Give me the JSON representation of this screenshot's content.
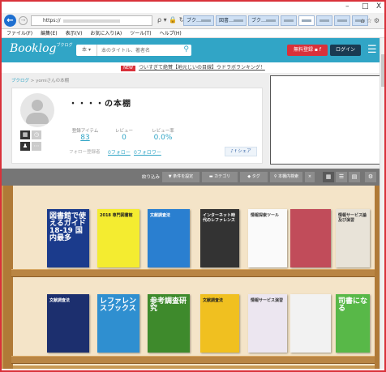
{
  "window": {
    "minimize": "–",
    "restore": "□",
    "close": "X"
  },
  "browser": {
    "url": "https://",
    "tabs": [
      {
        "label": "ブク…",
        "active": false
      },
      {
        "label": "図書…",
        "active": false
      },
      {
        "label": "ブク…",
        "active": false
      },
      {
        "label": "",
        "active": false
      },
      {
        "label": "",
        "active": true
      },
      {
        "label": "",
        "active": false
      },
      {
        "label": "",
        "active": false
      },
      {
        "label": "",
        "active": false
      }
    ],
    "menu": [
      "ファイル(F)",
      "編集(E)",
      "表示(V)",
      "お気に入り(A)",
      "ツール(T)",
      "ヘルプ(H)"
    ]
  },
  "header": {
    "logo": "Booklog",
    "logo_sub": "ブクログ",
    "search_select": "本",
    "search_placeholder": "本のタイトル、著者名",
    "register_label": "無料登録",
    "login_label": "ログイン"
  },
  "notice": {
    "badge": "NEW",
    "text": "ついすぎて絶賛【地元じいの目線】ウドラボランキング！"
  },
  "breadcrumb": {
    "home": "ブクログ",
    "sep": " > ",
    "current": "yomiさんの本棚"
  },
  "profile": {
    "title": "・・・・の本棚",
    "stats": [
      {
        "label": "登録アイテム",
        "value": "83",
        "underline": true
      },
      {
        "label": "レビュー",
        "value": "0",
        "underline": false
      },
      {
        "label": "レビュー率",
        "value": "0.0%",
        "underline": false
      }
    ],
    "registered": "フォロー登録者",
    "following": "0フォロー",
    "followers": "0フォロワー",
    "share": "シェア"
  },
  "filter": {
    "label": "絞り込み",
    "buttons": [
      "条件を設定",
      "カテゴリ",
      "タグ",
      "本棚内検索",
      "×"
    ]
  },
  "books_row1": [
    {
      "title": "図書館で使えるガイド18-19 国内最多",
      "bg": "#1b3b8c",
      "fg": "#fff",
      "big": true
    },
    {
      "title": "2018 専門図書館",
      "bg": "#f4ec30",
      "fg": "#222",
      "big": false
    },
    {
      "title": "文献調査法",
      "bg": "#2a7fd0",
      "fg": "#fff",
      "big": false
    },
    {
      "title": "インターネット時代のレファレンス",
      "bg": "#333",
      "fg": "#fff",
      "big": false
    },
    {
      "title": "情報探索ツール",
      "bg": "#fafafa",
      "fg": "#333",
      "big": false
    },
    {
      "title": "",
      "bg": "#c14c5a",
      "fg": "#fff",
      "big": false
    },
    {
      "title": "情報サービス論及び演習",
      "bg": "#e8e3d8",
      "fg": "#333",
      "big": false
    }
  ],
  "books_row2": [
    {
      "title": "文献調査法",
      "bg": "#1c2f6e",
      "fg": "#fff",
      "big": false
    },
    {
      "title": "レファレンスブックス",
      "bg": "#2f8fd0",
      "fg": "#fff",
      "big": true
    },
    {
      "title": "参考調査研究",
      "bg": "#3e8a2c",
      "fg": "#fff",
      "big": true
    },
    {
      "title": "文献調査法",
      "bg": "#f0c020",
      "fg": "#222",
      "big": false
    },
    {
      "title": "情報サービス演習",
      "bg": "#ece6f0",
      "fg": "#333",
      "big": false
    },
    {
      "title": "",
      "bg": "#f2f2f2",
      "fg": "#333",
      "big": false
    },
    {
      "title": "司書になる",
      "bg": "#58b848",
      "fg": "#fff",
      "big": true
    }
  ]
}
